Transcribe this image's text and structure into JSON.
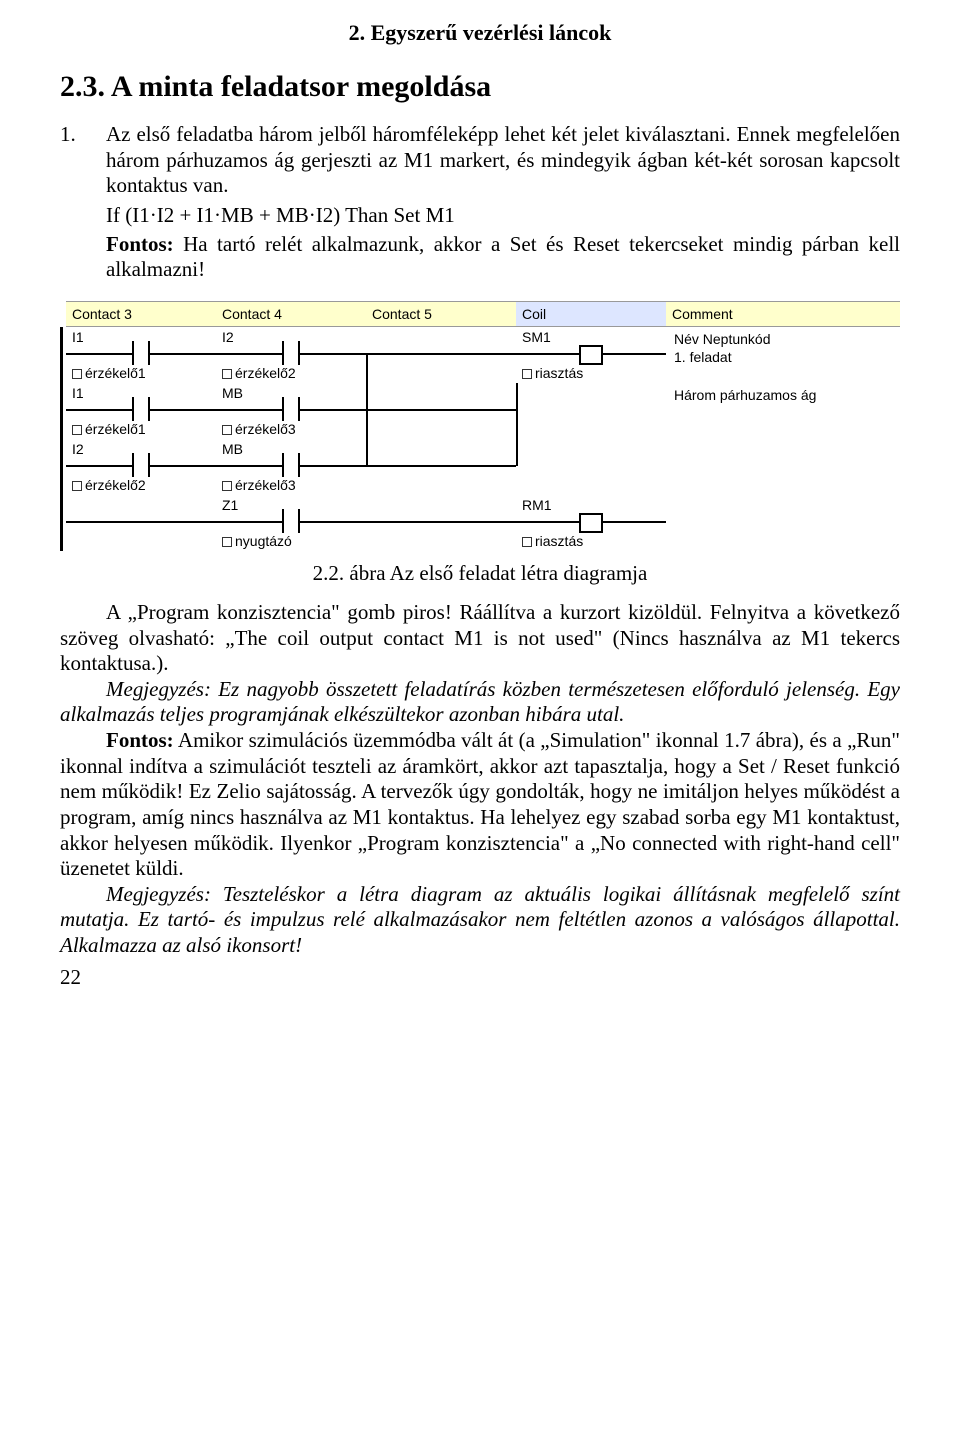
{
  "header": {
    "title": "2. Egyszerű vezérlési láncok"
  },
  "section": {
    "title": "2.3. A minta feladatsor megoldása"
  },
  "item1": {
    "num": "1.",
    "p1": "Az első feladatba három jelből háromféleképp lehet két jelet kiválasztani. Ennek megfelelően három párhuzamos ág gerjeszti az M1 markert, és mindegyik ágban két-két sorosan kapcsolt kontaktus van.",
    "formula": "If (I1·I2 + I1·MB + MB·I2) Than Set M1",
    "fontos_label": "Fontos:",
    "fontos_text": " Ha tartó relét alkalmazunk, akkor a Set és Reset tekercseket mindig párban kell alkalmazni!"
  },
  "ladder": {
    "headers": [
      "Contact 3",
      "Contact 4",
      "Contact 5",
      "Coil",
      "Comment"
    ],
    "rows": [
      {
        "c3_top": "I1",
        "c3_bot": "érzékelő1",
        "c4_top": "I2",
        "c4_bot": "érzékelő2",
        "c5_top": "",
        "c5_bot": "",
        "coil_top": "SM1",
        "coil_bot": "riasztás",
        "comment": "Név  Neptunkód\n1. feladat",
        "has_c3": true,
        "has_c4": true,
        "has_coil": true,
        "join_down": true
      },
      {
        "c3_top": "I1",
        "c3_bot": "érzékelő1",
        "c4_top": "MB",
        "c4_bot": "érzékelő3",
        "c5_top": "",
        "c5_bot": "",
        "coil_top": "",
        "coil_bot": "",
        "comment": "Három párhuzamos ág",
        "has_c3": true,
        "has_c4": true,
        "has_coil": false,
        "join_down": true,
        "join_up": true
      },
      {
        "c3_top": "I2",
        "c3_bot": "érzékelő2",
        "c4_top": "MB",
        "c4_bot": "érzékelő3",
        "c5_top": "",
        "c5_bot": "",
        "coil_top": "",
        "coil_bot": "",
        "comment": "",
        "has_c3": true,
        "has_c4": true,
        "has_coil": false,
        "join_up": true
      },
      {
        "c3_top": "",
        "c3_bot": "",
        "c4_top": "Z1",
        "c4_bot": "nyugtázó",
        "c5_top": "",
        "c5_bot": "",
        "coil_top": "RM1",
        "coil_bot": "riasztás",
        "comment": "",
        "has_c3": false,
        "has_c4": true,
        "has_coil": true
      }
    ]
  },
  "caption": "2.2. ábra Az első feladat létra diagramja",
  "body": {
    "p1a": "A „Program konzisztencia\" gomb piros! Ráállítva a kurzort kizöldül. Felnyitva a következő szöveg olvasható: „The coil output contact M1 is not used\" (Nincs használva az M1 tekercs kontaktusa.).",
    "p2": "Megjegyzés: Ez nagyobb összetett feladatírás közben természetesen előforduló jelenség. Egy alkalmazás teljes programjának elkészültekor azonban hibára utal.",
    "p3_label": "Fontos:",
    "p3": " Amikor szimulációs üzemmódba vált át (a „Simulation\" ikonnal 1.7 ábra), és a „Run\" ikonnal indítva a szimulációt teszteli az áramkört, akkor azt tapasztalja, hogy a Set / Reset funkció nem működik! Ez Zelio sajátosság. A tervezők úgy gondolták, hogy ne imitáljon helyes működést a program, amíg nincs használva az M1 kontaktus. Ha lehelyez egy szabad sorba egy M1 kontaktust, akkor helyesen működik. Ilyenkor „Program konzisztencia\" a „No connected with right-hand cell\" üzenetet küldi.",
    "p4": "Megjegyzés: Teszteléskor a létra diagram az aktuális logikai állításnak megfelelő színt mutatja. Ez tartó- és impulzus relé alkalmazásakor nem feltétlen azonos a valóságos állapottal. Alkalmazza az alsó ikonsort!"
  },
  "page_num": "22"
}
